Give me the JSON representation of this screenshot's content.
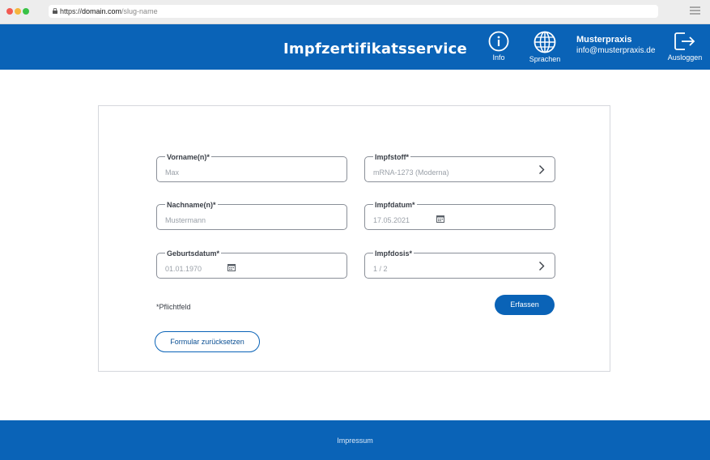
{
  "browser": {
    "url_scheme": "https://",
    "url_host": "domain.com",
    "url_path": "/slug-name"
  },
  "header": {
    "title": "Impfzertifikatsservice",
    "info_label": "Info",
    "language_label": "Sprachen",
    "account_name": "Musterpraxis",
    "account_email": "info@musterpraxis.de",
    "logout_label": "Ausloggen"
  },
  "form": {
    "first_name": {
      "label": "Vorname(n)*",
      "value": "Max"
    },
    "last_name": {
      "label": "Nachname(n)*",
      "value": "Mustermann"
    },
    "birth_date": {
      "label": "Geburtsdatum*",
      "value": "01.01.1970"
    },
    "vaccine": {
      "label": "Impfstoff*",
      "value": "mRNA-1273 (Moderna)"
    },
    "vaccination_date": {
      "label": "Impfdatum*",
      "value": "17.05.2021"
    },
    "dose": {
      "label": "Impfdosis*",
      "value": "1 / 2"
    },
    "required_note": "*Pflichtfeld",
    "submit_label": "Erfassen",
    "reset_label": "Formular zurücksetzen"
  },
  "footer": {
    "imprint_label": "Impressum"
  },
  "colors": {
    "brand_blue": "#0a63b7",
    "field_border": "#8a8f98",
    "placeholder_text": "#9aa0a8"
  }
}
